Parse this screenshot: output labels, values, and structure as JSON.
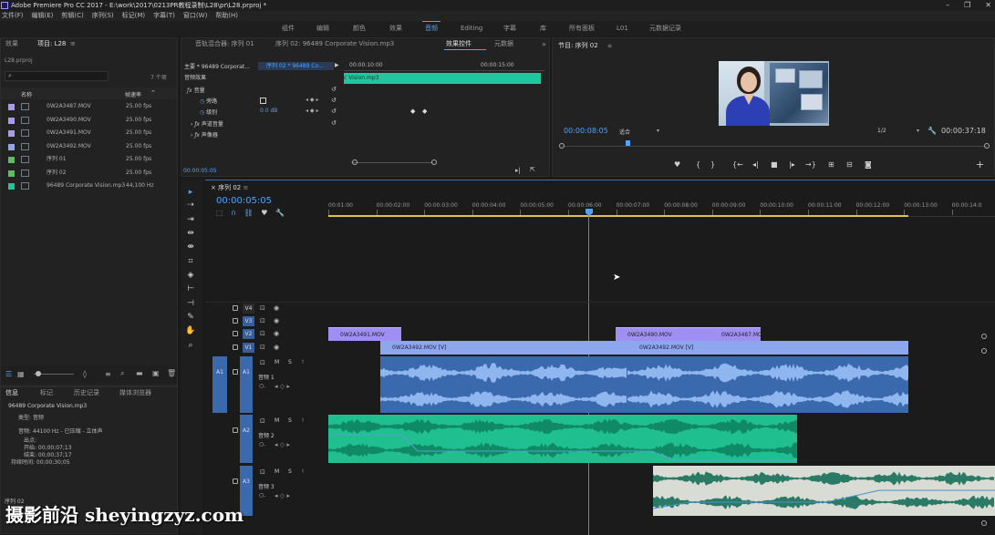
{
  "app": {
    "title": "Adobe Premiere Pro CC 2017 - E:\\work\\2017\\0213PR教程录制\\L28\\pr\\L28.prproj *"
  },
  "menu": [
    "文件(F)",
    "编辑(E)",
    "剪辑(C)",
    "序列(S)",
    "标记(M)",
    "字幕(T)",
    "窗口(W)",
    "帮助(H)"
  ],
  "workspaces": {
    "items": [
      "组件",
      "编辑",
      "颜色",
      "效果",
      "音频",
      "Editing",
      "字幕",
      "库",
      "所有面板",
      "L01",
      "元数据记录"
    ],
    "active": "音频"
  },
  "project_panel": {
    "tabs": [
      "效果",
      "项目: L28",
      "≡"
    ],
    "file": "L28.prproj",
    "item_count": "7 个项",
    "col_name": "名称",
    "col_fps": "帧速率",
    "items": [
      {
        "name": "0W2A3487.MOV",
        "fps": "25.00 fps",
        "color": "#a99af0"
      },
      {
        "name": "0W2A3490.MOV",
        "fps": "25.00 fps",
        "color": "#a99af0"
      },
      {
        "name": "0W2A3491.MOV",
        "fps": "25.00 fps",
        "color": "#a99af0"
      },
      {
        "name": "0W2A3492.MOV",
        "fps": "25.00 fps",
        "color": "#8ea6ee"
      },
      {
        "name": "序列 01",
        "fps": "25.00 fps",
        "color": "#5bc05b"
      },
      {
        "name": "序列 02",
        "fps": "25.00 fps",
        "color": "#5bc05b"
      },
      {
        "name": "96489 Corporate Vision.mp3",
        "fps": "44,100 Hz",
        "color": "#23c49a"
      }
    ]
  },
  "info_panel": {
    "tabs": [
      "信息",
      "标记",
      "历史记录",
      "媒体浏览器"
    ],
    "name": "96489 Corporate Vision.mp3",
    "type": "类型: 音频",
    "audio": "音频: 44100 Hz - 已压缩 - 立体声",
    "lines": [
      "出点:",
      "开始: 00;00;07;13",
      "结束: 00;00;37;17",
      "持续时间: 00;00;30;05"
    ],
    "seq": "序列 02"
  },
  "effect_controls": {
    "tabs": [
      "音轨混合器: 序列 01",
      "序列 02: 96489 Corporate Vision.mp3",
      "效果控件",
      "元数据"
    ],
    "master": "主要 * 96489 Corporat...",
    "seq_clip": "序列 02 * 96489 Co...",
    "ruler_a": "00:00:10:00",
    "ruler_b": "00:00:15:00",
    "clip_label": "c Vision.mp3",
    "section": "音频效果",
    "fx_volume": "音量",
    "bypass": "旁路",
    "level": "级别",
    "level_value": "0.0 dB",
    "channel_volume": "声道音量",
    "panner": "声像器",
    "timecode": "00:00:05:05"
  },
  "program_monitor": {
    "title": "节目: 序列 02",
    "timecode": "00:00:08:05",
    "fit": "适合",
    "resolution": "1/2",
    "duration": "00:00:37:18"
  },
  "timeline": {
    "tab": "序列 02",
    "timecode": "00:00:05:05",
    "ruler": [
      "00:01:00",
      "00:00:02:00",
      "00:00:03:00",
      "00:00:04:00",
      "00:00:05:00",
      "00:00:06:00",
      "00:00:07:00",
      "00:00:08:00",
      "00:00:09:00",
      "00:00:10:00",
      "00:00:11:00",
      "00:00:12:00",
      "00:00:13:00",
      "00:00:14:0"
    ],
    "video_tracks": [
      "V4",
      "V3",
      "V2",
      "V1"
    ],
    "audio_tracks": [
      {
        "src": "A1",
        "id": "A1",
        "name": "音频 1"
      },
      {
        "src": "",
        "id": "A2",
        "name": "音频 2"
      },
      {
        "src": "",
        "id": "A3",
        "name": "音频 3"
      }
    ],
    "clips": {
      "v2_a": "0W2A3491.MOV",
      "v2_b": "0W2A3490.MOV",
      "v2_c": "0W2A3487.MO",
      "v1_a": "0W2A3492.MOV [V]",
      "v1_b": "0W2A3492.MOV [V]"
    },
    "colors": {
      "video": "#a594f4",
      "v1": "#8ea6ee",
      "a1": "#3f71b6",
      "a2": "#1fbf8f",
      "a3": "#d8dcd4",
      "accent": "#4da3ff"
    }
  },
  "watermark": "摄影前沿 sheyingzyz.com"
}
